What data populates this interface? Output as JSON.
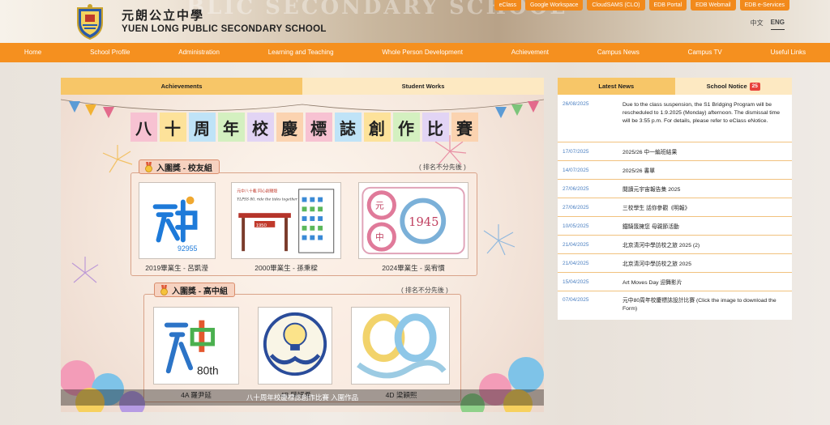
{
  "header": {
    "school_name_zh": "元朗公立中學",
    "school_name_en": "YUEN LONG PUBLIC SECONDARY SCHOOL",
    "banner_text": "BLIC SECONDARY SCHOOL",
    "quick_links": [
      "eClass",
      "Google Workspace",
      "CloudSAMS (CLO)",
      "EDB Portal",
      "EDB Webmail",
      "EDB e-Services"
    ],
    "lang": {
      "zh": "中文",
      "en": "ENG"
    }
  },
  "nav": [
    "Home",
    "School Profile",
    "Administration",
    "Learning and Teaching",
    "Whole Person Development",
    "Achievement",
    "Campus News",
    "Campus TV",
    "Useful Links"
  ],
  "left_tabs": {
    "achievements": "Achievements",
    "student_works": "Student Works"
  },
  "slide": {
    "title_chars": [
      "八",
      "十",
      "周",
      "年",
      "校",
      "慶",
      "標",
      "誌",
      "創",
      "作",
      "比",
      "賽"
    ],
    "alumni_group": {
      "label": "入圍獎 - 校友組",
      "order_note": "( 排名不分先後 )",
      "entries": [
        {
          "caption": "2019畢業生 - 呂凱瀅",
          "year_text": "92955"
        },
        {
          "caption": "2000畢業生 - 孫秉樑",
          "year_text": "1950",
          "text_top": "元中八十載 同心創輝煌",
          "text_mid": "YLPSS 80, ride the tides together"
        },
        {
          "caption": "2024畢業生 - 吳宥慣",
          "year_text": "1945"
        }
      ]
    },
    "senior_group": {
      "label": "入圍獎 - 高中組",
      "order_note": "( 排名不分先後 )",
      "entries": [
        {
          "caption": "4A 羅尹延",
          "year_text": "80th"
        },
        {
          "caption": "4B 陳妍希"
        },
        {
          "caption": "4D 梁穎熙"
        }
      ]
    },
    "caption": "八十周年校慶標誌創作比賽 入圍作品"
  },
  "right_tabs": {
    "latest_news": "Latest News",
    "school_notice": "School Notice",
    "notice_count": "25"
  },
  "news": [
    {
      "date": "26/08/2025",
      "title": "Due to the class suspension, the S1 Bridging Program will be rescheduled to 1.9.2025 (Monday) afternoon. The dismissal time will be 3:55 p.m. For details, please refer to eClass eNotice."
    },
    {
      "date": "17/07/2025",
      "title": "2025/26 中一編班結果"
    },
    {
      "date": "14/07/2025",
      "title": "2025/26 書單"
    },
    {
      "date": "27/06/2025",
      "title": "閱讀元宇宙報告集 2025"
    },
    {
      "date": "27/06/2025",
      "title": "三校學生 話你參觀《明報》"
    },
    {
      "date": "10/05/2025",
      "title": "鐵騎簇擁您 母親節活動"
    },
    {
      "date": "21/04/2025",
      "title": "北京清河中學訪校之旅 2025 (2)"
    },
    {
      "date": "21/04/2025",
      "title": "北京清河中學訪校之旅 2025"
    },
    {
      "date": "15/04/2025",
      "title": "Art Moves Day 迎舞影片"
    },
    {
      "date": "07/04/2025",
      "title": "元中80周年校慶標誌設計比賽 (Click the image to download the Form)"
    }
  ],
  "colors": {
    "brand_orange": "#f5901f",
    "tab_active": "#f7c668",
    "tab_inactive": "#fde9c2",
    "link_blue": "#4a7fc1",
    "badge_red": "#e8413c"
  }
}
